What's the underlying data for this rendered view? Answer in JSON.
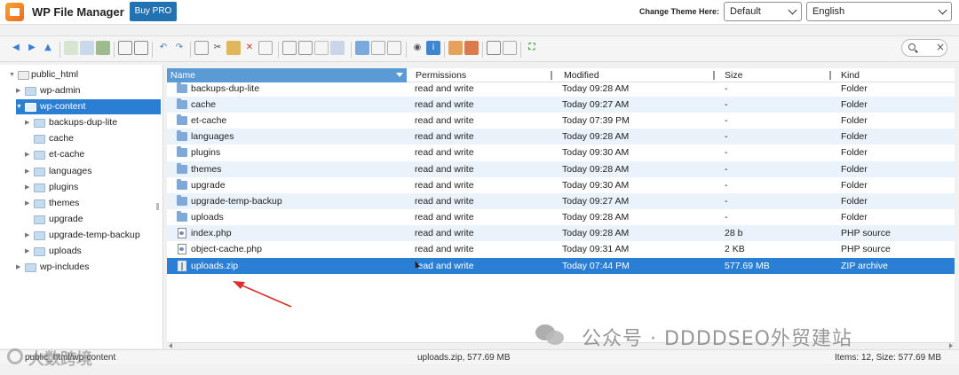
{
  "header": {
    "app_title": "WP File Manager",
    "buy_label": "Buy PRO",
    "theme_label": "Change Theme Here:",
    "theme_value": "Default",
    "language_value": "English"
  },
  "toolbar": {
    "search_clear": "×"
  },
  "tree": {
    "root": "public_html",
    "items": [
      {
        "label": "wp-admin"
      },
      {
        "label": "wp-content"
      },
      {
        "label": "backups-dup-lite"
      },
      {
        "label": "cache"
      },
      {
        "label": "et-cache"
      },
      {
        "label": "languages"
      },
      {
        "label": "plugins"
      },
      {
        "label": "themes"
      },
      {
        "label": "upgrade"
      },
      {
        "label": "upgrade-temp-backup"
      },
      {
        "label": "uploads"
      },
      {
        "label": "wp-includes"
      }
    ]
  },
  "grid": {
    "columns": {
      "name": "Name",
      "permissions": "Permissions",
      "modified": "Modified",
      "size": "Size",
      "kind": "Kind"
    },
    "rows": [
      {
        "name": "backups-dup-lite",
        "permissions": "read and write",
        "modified": "Today 09:28 AM",
        "size": "-",
        "kind": "Folder"
      },
      {
        "name": "cache",
        "permissions": "read and write",
        "modified": "Today 09:27 AM",
        "size": "-",
        "kind": "Folder"
      },
      {
        "name": "et-cache",
        "permissions": "read and write",
        "modified": "Today 07:39 PM",
        "size": "-",
        "kind": "Folder"
      },
      {
        "name": "languages",
        "permissions": "read and write",
        "modified": "Today 09:28 AM",
        "size": "-",
        "kind": "Folder"
      },
      {
        "name": "plugins",
        "permissions": "read and write",
        "modified": "Today 09:30 AM",
        "size": "-",
        "kind": "Folder"
      },
      {
        "name": "themes",
        "permissions": "read and write",
        "modified": "Today 09:28 AM",
        "size": "-",
        "kind": "Folder"
      },
      {
        "name": "upgrade",
        "permissions": "read and write",
        "modified": "Today 09:30 AM",
        "size": "-",
        "kind": "Folder"
      },
      {
        "name": "upgrade-temp-backup",
        "permissions": "read and write",
        "modified": "Today 09:27 AM",
        "size": "-",
        "kind": "Folder"
      },
      {
        "name": "uploads",
        "permissions": "read and write",
        "modified": "Today 09:28 AM",
        "size": "-",
        "kind": "Folder"
      },
      {
        "name": "index.php",
        "permissions": "read and write",
        "modified": "Today 09:28 AM",
        "size": "28 b",
        "kind": "PHP source"
      },
      {
        "name": "object-cache.php",
        "permissions": "read and write",
        "modified": "Today 09:31 AM",
        "size": "2 KB",
        "kind": "PHP source"
      },
      {
        "name": "uploads.zip",
        "permissions": "read and write",
        "modified": "Today 07:44 PM",
        "size": "577.69 MB",
        "kind": "ZIP archive"
      }
    ]
  },
  "status": {
    "path": "public_html/wp-content",
    "selection": "uploads.zip, 577.69 MB",
    "items": "Items: 12, Size: 577.69 MB"
  },
  "watermark": {
    "text": "公众号 · DDDDSEO外贸建站",
    "brand": "大数跨境"
  },
  "colors": {
    "accent": "#2a7fd4",
    "header_blue": "#5b9bd5",
    "buy_button": "#2271b1",
    "row_alt": "#eaf2fb",
    "arrow": "#d9302c"
  }
}
